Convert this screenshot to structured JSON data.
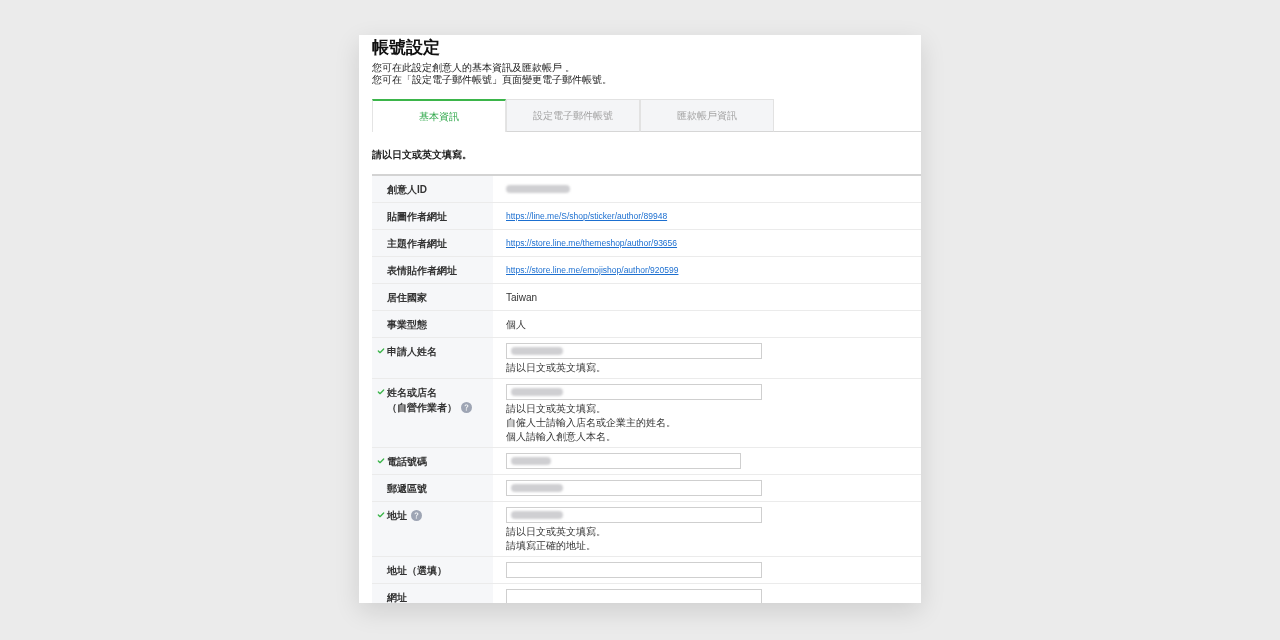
{
  "page": {
    "title": "帳號設定",
    "description": [
      "您可在此設定創意人的基本資訊及匯款帳戶 。",
      "您可在「設定電子郵件帳號」頁面變更電子郵件帳號。"
    ]
  },
  "tabs": [
    {
      "label": "基本資訊",
      "selected": true
    },
    {
      "label": "設定電子郵件帳號",
      "selected": false
    },
    {
      "label": "匯款帳戶資訊",
      "selected": false
    }
  ],
  "notice": "請以日文或英文填寫。",
  "rows": [
    {
      "label": "創意人ID",
      "kind": "blurred",
      "checked": false,
      "help": false
    },
    {
      "label": "貼圖作者網址",
      "kind": "link",
      "value": "https://line.me/S/shop/sticker/author/89948",
      "checked": false,
      "help": false
    },
    {
      "label": "主題作者網址",
      "kind": "link",
      "value": "https://store.line.me/themeshop/author/93656",
      "checked": false,
      "help": false
    },
    {
      "label": "表情貼作者網址",
      "kind": "link",
      "value": "https://store.line.me/emojishop/author/920599",
      "checked": false,
      "help": false
    },
    {
      "label": "居住國家",
      "kind": "text",
      "value": "Taiwan",
      "checked": false,
      "help": false
    },
    {
      "label": "事業型態",
      "kind": "text",
      "value": "個人",
      "checked": false,
      "help": false
    },
    {
      "label": "申請人姓名",
      "kind": "input",
      "filled": true,
      "short": false,
      "hints": [
        "請以日文或英文填寫。"
      ],
      "checked": true,
      "help": false
    },
    {
      "label": "姓名或店名",
      "note": "（自營作業者）",
      "kind": "input",
      "filled": true,
      "short": false,
      "hints": [
        "請以日文或英文填寫。",
        "自僱人士請輸入店名或企業主的姓名。",
        "個人請輸入創意人本名。"
      ],
      "checked": true,
      "help": true
    },
    {
      "label": "電話號碼",
      "kind": "input",
      "filled": true,
      "short": true,
      "checked": true,
      "help": false
    },
    {
      "label": "郵遞區號",
      "kind": "input",
      "filled": true,
      "short": false,
      "checked": false,
      "help": false
    },
    {
      "label": "地址",
      "kind": "input",
      "filled": true,
      "short": false,
      "hints": [
        "請以日文或英文填寫。",
        "請填寫正確的地址。"
      ],
      "checked": true,
      "help": true
    },
    {
      "label": "地址（選填）",
      "kind": "input",
      "filled": false,
      "short": false,
      "checked": false,
      "help": false
    },
    {
      "label": "網址",
      "kind": "input",
      "filled": false,
      "short": false,
      "checked": false,
      "help": false
    }
  ]
}
